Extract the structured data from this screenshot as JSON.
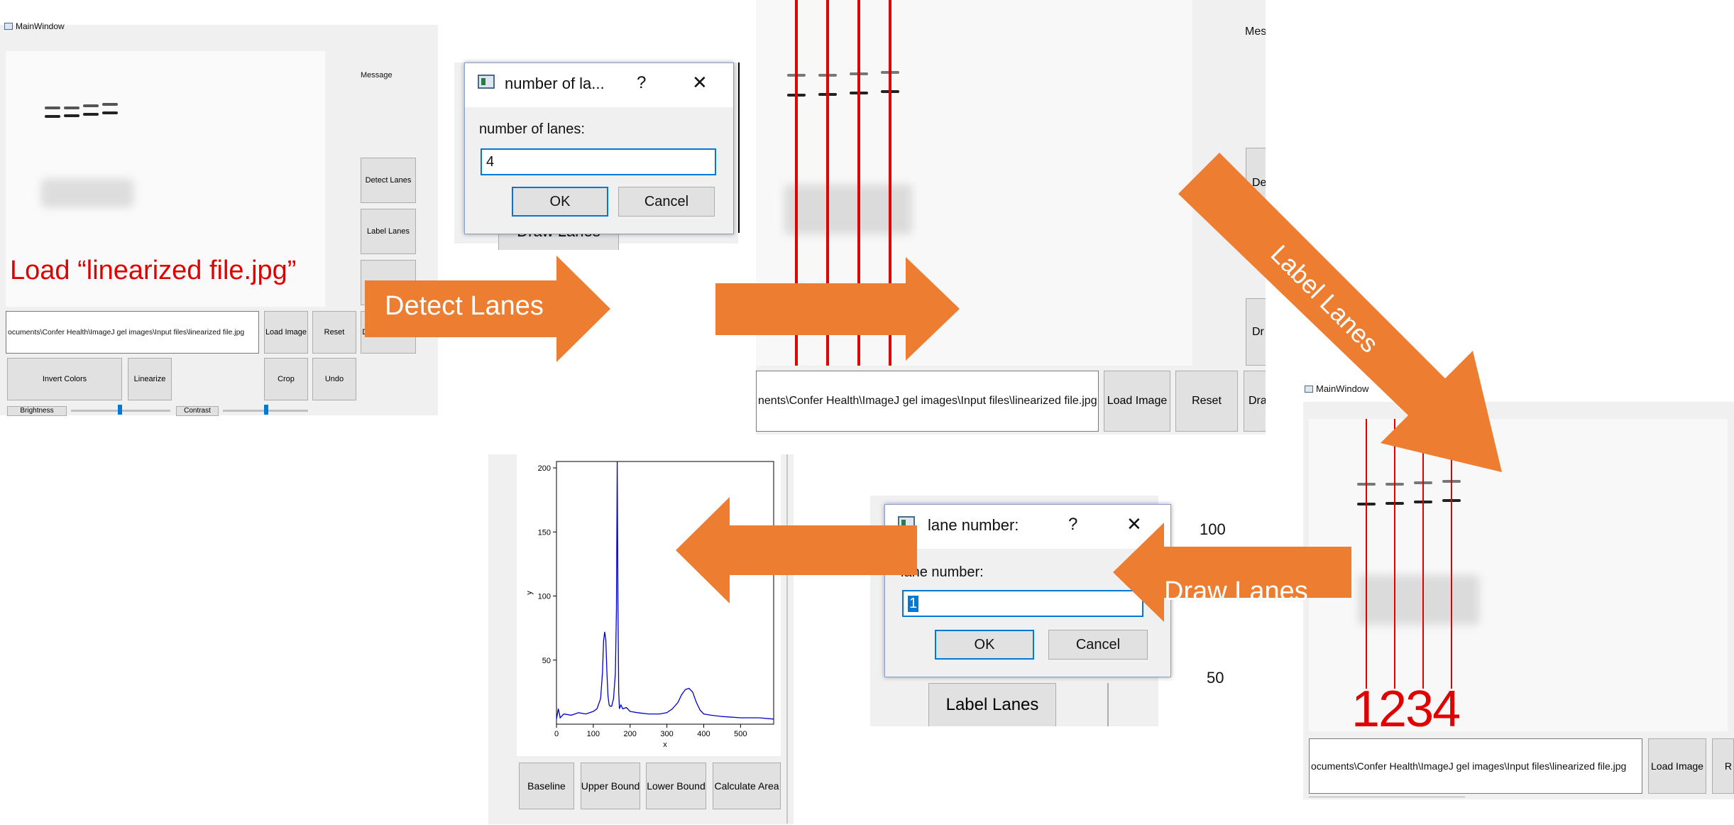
{
  "panel1": {
    "window_title": "MainWindow",
    "message_label": "Message",
    "detect_lanes": "Detect Lanes",
    "label_lanes": "Label Lanes",
    "draw_lanes_partial": "Draw Lanes",
    "draw_all_lanes": "Draw All Lanes",
    "path": "ocuments\\Confer Health\\ImageJ gel images\\Input files\\linearized file.jpg",
    "load_image": "Load Image",
    "reset": "Reset",
    "invert_colors": "Invert Colors",
    "linearize": "Linearize",
    "crop": "Crop",
    "undo": "Undo",
    "brightness": "Brightness",
    "contrast": "Contrast",
    "annotation": "Load “linearized file.jpg”"
  },
  "dialog1": {
    "title": "number of la...",
    "help": "?",
    "close": "✕",
    "label": "number of lanes:",
    "value": "4",
    "ok": "OK",
    "cancel": "Cancel",
    "behind_button": "Draw Lanes"
  },
  "panel3": {
    "message_partial": "Mes",
    "detect_partial": "De",
    "draw_partial": "Dr",
    "path": "nents\\Confer Health\\ImageJ gel images\\Input files\\linearized file.jpg",
    "load_image": "Load Image",
    "reset": "Reset",
    "partial_btn": "Dra"
  },
  "panel4": {
    "window_title": "MainWindow",
    "lane_numbers": "1234",
    "path": "ocuments\\Confer Health\\ImageJ gel images\\Input files\\linearized file.jpg",
    "load_image": "Load Image",
    "partial_btn": "R"
  },
  "dialog2": {
    "title": "lane number:",
    "help": "?",
    "close": "✕",
    "label": "lane number:",
    "value": "1",
    "ok": "OK",
    "cancel": "Cancel",
    "behind_button": "Label Lanes",
    "tick_100": "100",
    "tick_50": "50"
  },
  "plot_panel": {
    "baseline": "Baseline",
    "upper_bound": "Upper Bound",
    "lower_bound": "Lower Bound",
    "calculate_area": "Calculate Area"
  },
  "arrows": {
    "detect_lanes": "Detect Lanes",
    "label_lanes": "Label Lanes",
    "draw_lanes": "Draw Lanes"
  },
  "colors": {
    "arrow": "#ED7D31",
    "annotation_red": "#E00000",
    "plot_line": "#0000CC"
  },
  "chart_data": {
    "type": "line",
    "title": "",
    "xlabel": "x",
    "ylabel": "y",
    "xlim": [
      0,
      590
    ],
    "ylim": [
      0,
      205
    ],
    "x_ticks": [
      "0",
      "100",
      "200",
      "300",
      "400",
      "500"
    ],
    "y_ticks": [
      "50",
      "100",
      "150",
      "200"
    ],
    "series": [
      {
        "x": [
          0,
          5,
          10,
          20,
          40,
          60,
          80,
          100,
          110,
          120,
          125,
          128,
          131,
          134,
          137,
          140,
          143,
          146,
          150,
          155,
          160,
          163,
          165,
          167,
          169,
          171,
          175,
          180,
          190,
          200,
          220,
          250,
          280,
          300,
          315,
          330,
          340,
          350,
          360,
          370,
          380,
          390,
          400,
          420,
          450,
          500,
          550,
          590
        ],
        "y": [
          4,
          12,
          5,
          8,
          7,
          9,
          8,
          10,
          12,
          20,
          40,
          65,
          72,
          66,
          40,
          22,
          15,
          14,
          14,
          20,
          40,
          90,
          220,
          95,
          25,
          12,
          15,
          12,
          13,
          10,
          9,
          8,
          8,
          9,
          12,
          17,
          23,
          27,
          28,
          25,
          17,
          11,
          8,
          7,
          6,
          5,
          5,
          4
        ]
      }
    ]
  }
}
